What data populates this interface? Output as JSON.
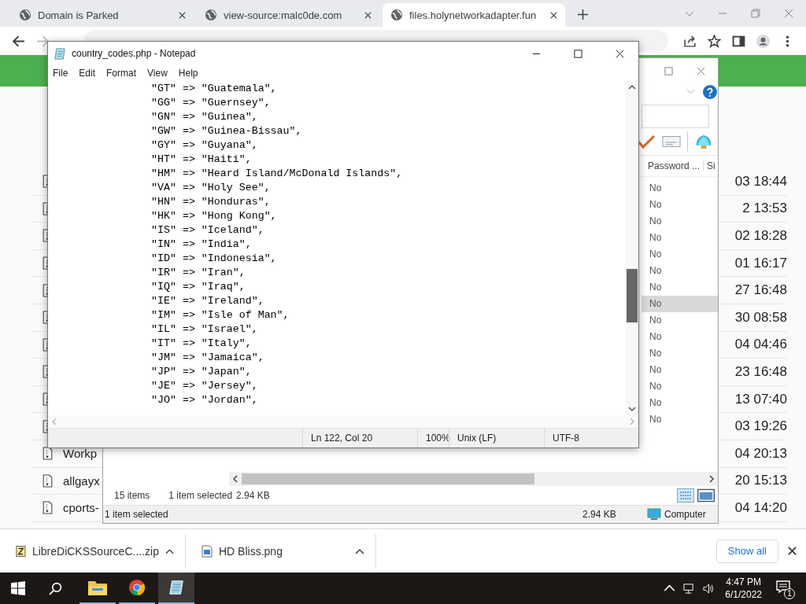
{
  "browser": {
    "tabs": [
      {
        "title": "Domain is Parked",
        "selected": false
      },
      {
        "title": "view-source:malc0de.com",
        "selected": false
      },
      {
        "title": "files.holynetworkadapter.fun",
        "selected": true
      }
    ]
  },
  "page_files": {
    "rows": [
      {
        "time": "03 18:44"
      },
      {
        "time": "2 13:53"
      },
      {
        "time": "02 18:28"
      },
      {
        "time": "01 16:17"
      },
      {
        "time": "27 16:48"
      },
      {
        "time": "30 08:58"
      },
      {
        "time": "04 04:46"
      },
      {
        "time": "23 16:48"
      },
      {
        "time": "13 07:40"
      },
      {
        "time": "03 19:26"
      },
      {
        "name": "Workp",
        "time": "04 20:13"
      },
      {
        "name": "allgayx",
        "time": "20 15:13"
      },
      {
        "name": "cports-",
        "time": "04 14:20"
      }
    ]
  },
  "archive_window": {
    "column_1": "Password ...",
    "column_2": "Si",
    "rows": [
      {
        "password": "No",
        "selected": false
      },
      {
        "password": "No",
        "selected": false
      },
      {
        "password": "No",
        "selected": false
      },
      {
        "password": "No",
        "selected": false
      },
      {
        "password": "No",
        "selected": false
      },
      {
        "password": "No",
        "selected": false
      },
      {
        "password": "No",
        "selected": false
      },
      {
        "password": "No",
        "selected": true
      },
      {
        "password": "No",
        "selected": false
      },
      {
        "password": "No",
        "selected": false
      },
      {
        "password": "No",
        "selected": false
      },
      {
        "password": "No",
        "selected": false
      },
      {
        "password": "No",
        "selected": false
      },
      {
        "password": "No",
        "selected": false
      },
      {
        "password": "No",
        "selected": false
      }
    ],
    "summary": {
      "count": "15 items",
      "selection": "1 item selected",
      "size": "2.94 KB"
    },
    "status_bar": {
      "selection": "1 item selected",
      "size": "2.94 KB",
      "location": "Computer"
    }
  },
  "notepad": {
    "title": "country_codes.php - Notepad",
    "menu": [
      "File",
      "Edit",
      "Format",
      "View",
      "Help"
    ],
    "lines": [
      "\"GT\" => \"Guatemala\",",
      "\"GG\" => \"Guernsey\",",
      "\"GN\" => \"Guinea\",",
      "\"GW\" => \"Guinea-Bissau\",",
      "\"GY\" => \"Guyana\",",
      "\"HT\" => \"Haiti\",",
      "\"HM\" => \"Heard Island/McDonald Islands\",",
      "\"VA\" => \"Holy See\",",
      "\"HN\" => \"Honduras\",",
      "\"HK\" => \"Hong Kong\",",
      "\"IS\" => \"Iceland\",",
      "\"IN\" => \"India\",",
      "\"ID\" => \"Indonesia\",",
      "\"IR\" => \"Iran\",",
      "\"IQ\" => \"Iraq\",",
      "\"IE\" => \"Ireland\",",
      "\"IM\" => \"Isle of Man\",",
      "\"IL\" => \"Israel\",",
      "\"IT\" => \"Italy\",",
      "\"JM\" => \"Jamaica\",",
      "\"JP\" => \"Japan\",",
      "\"JE\" => \"Jersey\",",
      "\"JO\" => \"Jordan\","
    ],
    "status": {
      "position": "Ln 122, Col 20",
      "zoom": "100%",
      "line_endings": "Unix (LF)",
      "encoding": "UTF-8"
    }
  },
  "downloads": {
    "items": [
      {
        "name": "LibreDiCKSSourceC....zip",
        "kind": "archive"
      },
      {
        "name": "HD Bliss.png",
        "kind": "image"
      }
    ],
    "show_all": "Show all"
  },
  "taskbar": {
    "apps": [
      {
        "kind": "folder",
        "selected": false
      },
      {
        "kind": "browser",
        "selected": false
      },
      {
        "kind": "notepad",
        "selected": true
      }
    ],
    "time": "4:47 PM",
    "date": "6/1/2022",
    "notifications": "1"
  }
}
